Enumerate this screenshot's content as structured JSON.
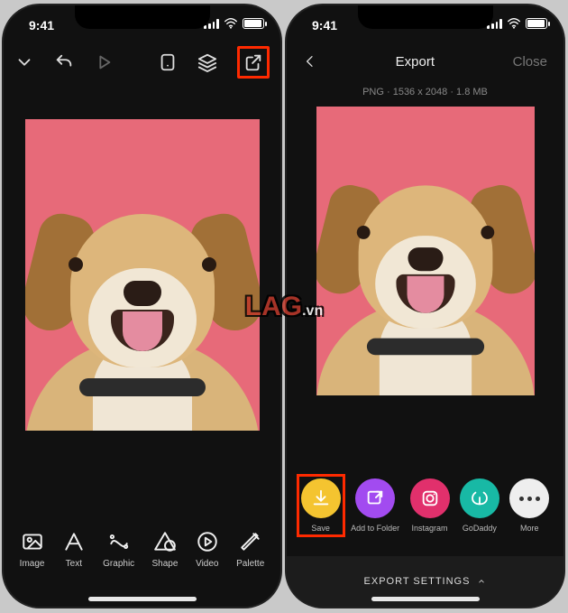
{
  "status": {
    "time": "9:41"
  },
  "left": {
    "toolbar": {
      "collapse": "collapse",
      "undo": "undo",
      "play": "play",
      "page": "page",
      "layers": "layers",
      "export": "export"
    },
    "tools": [
      {
        "key": "image",
        "label": "Image"
      },
      {
        "key": "text",
        "label": "Text"
      },
      {
        "key": "graphic",
        "label": "Graphic"
      },
      {
        "key": "shape",
        "label": "Shape"
      },
      {
        "key": "video",
        "label": "Video"
      },
      {
        "key": "palette",
        "label": "Palette"
      }
    ]
  },
  "right": {
    "header": {
      "back": "Back",
      "title": "Export",
      "close": "Close"
    },
    "meta": "PNG · 1536 x 2048 · 1.8 MB",
    "options": [
      {
        "key": "save",
        "label": "Save",
        "color": "c-save"
      },
      {
        "key": "folder",
        "label": "Add to Folder",
        "color": "c-folder"
      },
      {
        "key": "instagram",
        "label": "Instagram",
        "color": "c-ig"
      },
      {
        "key": "godaddy",
        "label": "GoDaddy",
        "color": "c-gd"
      },
      {
        "key": "more",
        "label": "More",
        "color": "c-more"
      }
    ],
    "settings_label": "EXPORT SETTINGS"
  },
  "canvas": {
    "bg": "#e76a79"
  },
  "watermark": "LAG"
}
